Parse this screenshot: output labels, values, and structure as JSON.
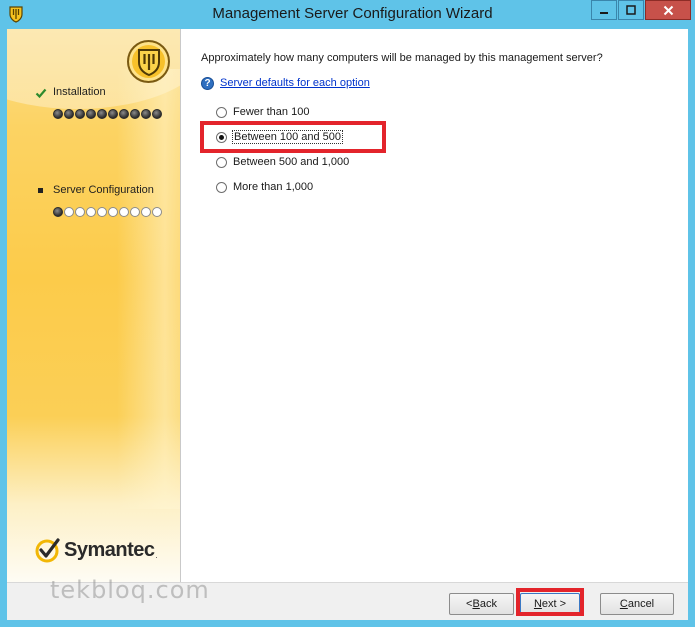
{
  "window": {
    "title": "Management Server Configuration Wizard",
    "controls": {
      "minimize": "–",
      "maximize": "□",
      "close": "✕"
    }
  },
  "sidebar": {
    "steps": [
      {
        "label": "Installation",
        "status": "complete",
        "progress": {
          "filled": 10,
          "total": 10
        }
      },
      {
        "label": "Server Configuration",
        "status": "current",
        "progress": {
          "filled": 1,
          "total": 10
        }
      }
    ],
    "brand": "Symantec",
    "brand_mark": "."
  },
  "main": {
    "question": "Approximately how many computers will be managed by this management server?",
    "help_link": "Server defaults for each option",
    "options": [
      {
        "label": "Fewer than 100",
        "selected": false
      },
      {
        "label": "Between 100 and 500",
        "selected": true
      },
      {
        "label": "Between 500 and 1,000",
        "selected": false
      },
      {
        "label": "More than 1,000",
        "selected": false
      }
    ]
  },
  "buttons": {
    "back_prefix": "< ",
    "back_accel": "B",
    "back_rest": "ack",
    "next_accel": "N",
    "next_rest": "ext >",
    "cancel_accel": "C",
    "cancel_rest": "ancel"
  },
  "watermark": "tekbloq.com",
  "colors": {
    "title_bar": "#5fc3e8",
    "close_button": "#c7514a",
    "highlight": "#e3242b",
    "link": "#0033cc"
  }
}
